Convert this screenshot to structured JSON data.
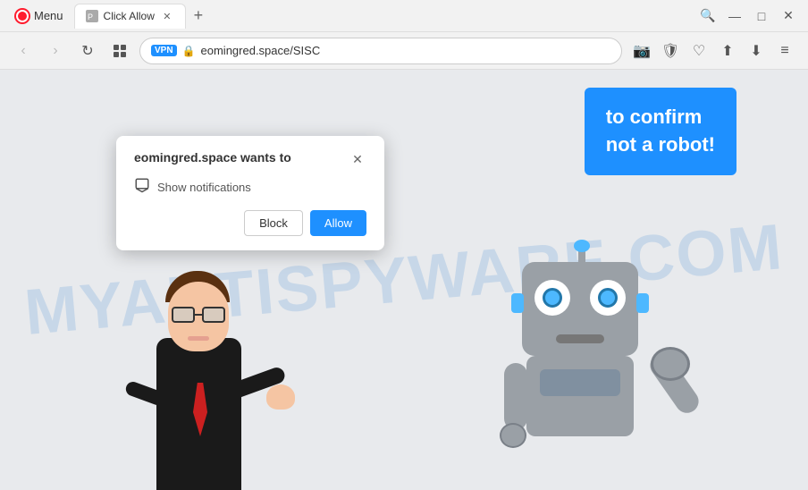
{
  "browser": {
    "title_bar": {
      "menu_label": "Menu",
      "tab_label": "Click Allow",
      "tab_favicon": "page",
      "new_tab_icon": "+",
      "search_icon": "🔍",
      "minimize_icon": "—",
      "maximize_icon": "□",
      "close_icon": "✕"
    },
    "address_bar": {
      "back_icon": "‹",
      "forward_icon": "›",
      "reload_icon": "↻",
      "tabs_grid_icon": "grid",
      "vpn_label": "VPN",
      "lock_icon": "🔒",
      "url": "eomingred.space/SISC",
      "url_domain": "eomingred.space",
      "url_path": "/SISC",
      "camera_icon": "📷",
      "shield_icon": "🛡",
      "heart_icon": "♡",
      "share_icon": "⬆",
      "download_icon": "⬇",
      "menu_dots_icon": "≡"
    }
  },
  "page": {
    "watermark": "MYANTISPYWARE.COM",
    "cta_box": {
      "line1": "to confirm",
      "line2": "not a robot!"
    }
  },
  "notification_popup": {
    "title": "eomingred.space wants to",
    "permission_label": "Show notifications",
    "close_icon": "✕",
    "block_button": "Block",
    "allow_button": "Allow"
  }
}
